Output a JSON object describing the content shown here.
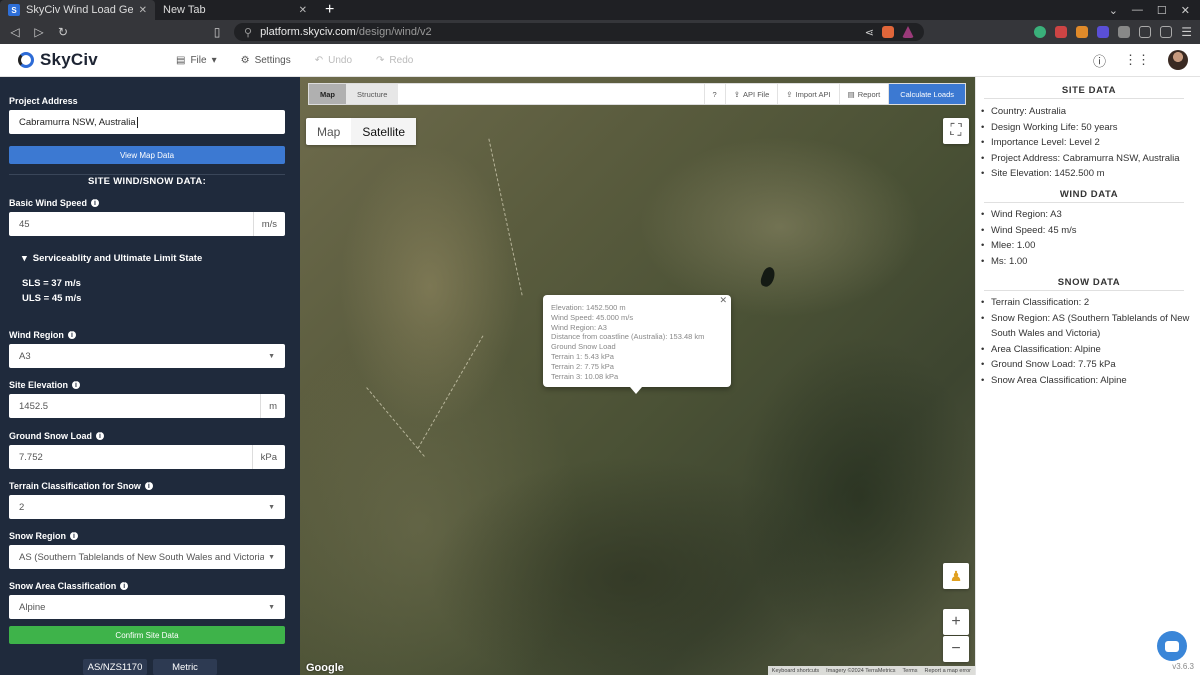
{
  "browser": {
    "tabs": [
      {
        "title": "SkyCiv Wind Load Generat",
        "active": true
      },
      {
        "title": "New Tab",
        "active": false
      }
    ],
    "url_host": "platform.skyciv.com",
    "url_path": "/design/wind/v2"
  },
  "header": {
    "brand": "SkyCiv",
    "menu": {
      "file": "File",
      "settings": "Settings",
      "undo": "Undo",
      "redo": "Redo"
    }
  },
  "sidebar": {
    "project_address_label": "Project Address",
    "project_address_value": "Cabramurra NSW, Australia",
    "view_map_button": "View Map Data",
    "site_section_title": "SITE WIND/SNOW DATA:",
    "wind_speed_label": "Basic Wind Speed",
    "wind_speed_value": "45",
    "wind_speed_unit": "m/s",
    "limit_state_label": "Serviceablity and Ultimate Limit State",
    "sls_text": "SLS = 37 m/s",
    "uls_text": "ULS = 45 m/s",
    "wind_region_label": "Wind Region",
    "wind_region_value": "A3",
    "site_elevation_label": "Site Elevation",
    "site_elevation_value": "1452.5",
    "site_elevation_unit": "m",
    "ground_snow_label": "Ground Snow Load",
    "ground_snow_value": "7.752",
    "ground_snow_unit": "kPa",
    "terrain_label": "Terrain Classification for Snow",
    "terrain_value": "2",
    "snow_region_label": "Snow Region",
    "snow_region_value": "AS (Southern Tablelands of New South Wales and Victoria)",
    "snow_area_label": "Snow Area Classification",
    "snow_area_value": "Alpine",
    "confirm_button": "Confirm Site Data",
    "standard": "AS/NZS1170",
    "units": "Metric"
  },
  "map": {
    "tabs": {
      "map": "Map",
      "structure": "Structure"
    },
    "buttons": {
      "help": "?",
      "api_file": "API File",
      "import_api": "Import API",
      "report": "Report",
      "calculate": "Calculate Loads"
    },
    "maptype": {
      "map": "Map",
      "satellite": "Satellite"
    },
    "popup_lines": [
      "Elevation: 1452.500 m",
      "Wind Speed: 45.000 m/s",
      "Wind Region: A3",
      "Distance from coastline (Australia): 153.48 km",
      "Ground Snow Load",
      "Terrain 1: 5.43 kPa",
      "Terrain 2: 7.75 kPa",
      "Terrain 3: 10.08 kPa"
    ],
    "google": "Google",
    "attribution": {
      "shortcuts": "Keyboard shortcuts",
      "imagery": "Imagery ©2024 TerraMetrics",
      "terms": "Terms",
      "report": "Report a map error"
    }
  },
  "right_panel": {
    "site_title": "SITE DATA",
    "site_items": [
      "Country: Australia",
      "Design Working Life: 50 years",
      "Importance Level: Level 2",
      "Project Address: Cabramurra NSW, Australia",
      "Site Elevation: 1452.500 m"
    ],
    "wind_title": "WIND DATA",
    "wind_items": [
      "Wind Region: A3",
      "Wind Speed: 45 m/s",
      "Mlee: 1.00",
      "Ms: 1.00"
    ],
    "snow_title": "SNOW DATA",
    "snow_items": [
      "Terrain Classification: 2",
      "Snow Region: AS (Southern Tablelands of New South Wales and Victoria)",
      "Area Classification: Alpine",
      "Ground Snow Load: 7.75 kPa",
      "Snow Area Classification: Alpine"
    ],
    "version": "v3.6.3"
  }
}
